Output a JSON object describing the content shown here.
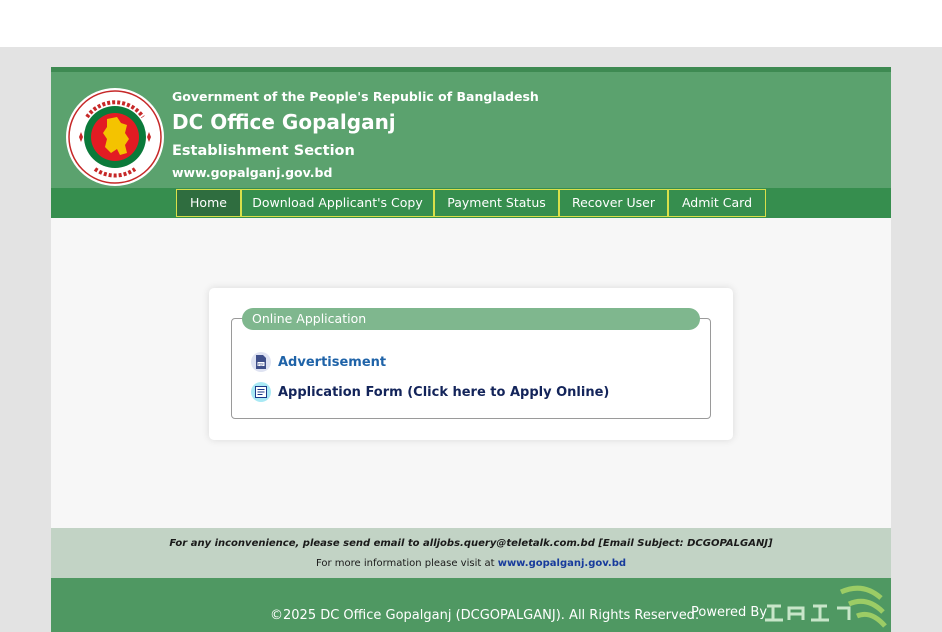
{
  "header": {
    "government": "Government of the People's Republic of Bangladesh",
    "office": "DC Office Gopalganj",
    "section": "Establishment Section",
    "website": "www.gopalganj.gov.bd"
  },
  "nav": {
    "items": [
      {
        "label": "Home",
        "active": true
      },
      {
        "label": "Download Applicant's Copy",
        "active": false
      },
      {
        "label": "Payment Status",
        "active": false
      },
      {
        "label": "Recover User",
        "active": false
      },
      {
        "label": "Admit Card",
        "active": false
      }
    ]
  },
  "panel": {
    "legend": "Online Application",
    "links": [
      {
        "label": "Advertisement",
        "icon": "pdf-icon"
      },
      {
        "label": "Application Form (Click here to Apply Online)",
        "icon": "form-icon"
      }
    ]
  },
  "footer": {
    "note": "For any inconvenience, please send email to alljobs.query@teletalk.com.bd [Email Subject: DCGOPALGANJ]",
    "info_prefix": "For more information please visit at",
    "info_link": "www.gopalganj.gov.bd",
    "copyright": "©2025 DC Office Gopalganj (DCGOPALGANJ). All Rights Reserved.",
    "powered_by": "Powered By"
  },
  "colors": {
    "header_green": "#5ba26e",
    "nav_green": "#368e4e",
    "legend_green": "#7fb78e",
    "footer_gray_green": "#c2d3c5",
    "footer_green": "#4f9862"
  }
}
